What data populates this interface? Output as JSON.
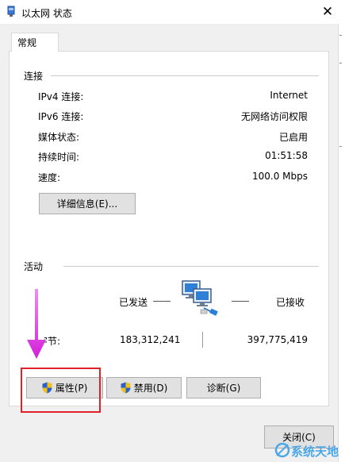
{
  "window": {
    "title": "以太网 状态",
    "close_glyph": "✕"
  },
  "tabs": [
    {
      "label": "常规"
    }
  ],
  "connection": {
    "header": "连接",
    "rows": [
      {
        "label": "IPv4 连接:",
        "value": "Internet"
      },
      {
        "label": "IPv6 连接:",
        "value": "无网络访问权限"
      },
      {
        "label": "媒体状态:",
        "value": "已启用"
      },
      {
        "label": "持续时间:",
        "value": "01:51:58"
      },
      {
        "label": "速度:",
        "value": "100.0 Mbps"
      }
    ],
    "details_button": "详细信息(E)..."
  },
  "activity": {
    "header": "活动",
    "sent_label": "已发送",
    "received_label": "已接收",
    "bytes_label": "字节:",
    "bytes_sent": "183,312,241",
    "bytes_received": "397,775,419"
  },
  "buttons": {
    "properties": "属性(P)",
    "disable": "禁用(D)",
    "diagnose": "诊断(G)",
    "close": "关闭(C)"
  },
  "watermark": {
    "text": "系统天地"
  },
  "colors": {
    "highlight_box": "#e0202a",
    "arrow": "#e040e8",
    "shield_blue": "#2a62c9",
    "shield_yellow": "#f2c21b"
  },
  "icons": [
    "network-ethernet-icon",
    "shield-icon",
    "close-icon",
    "arrow-annotation"
  ]
}
